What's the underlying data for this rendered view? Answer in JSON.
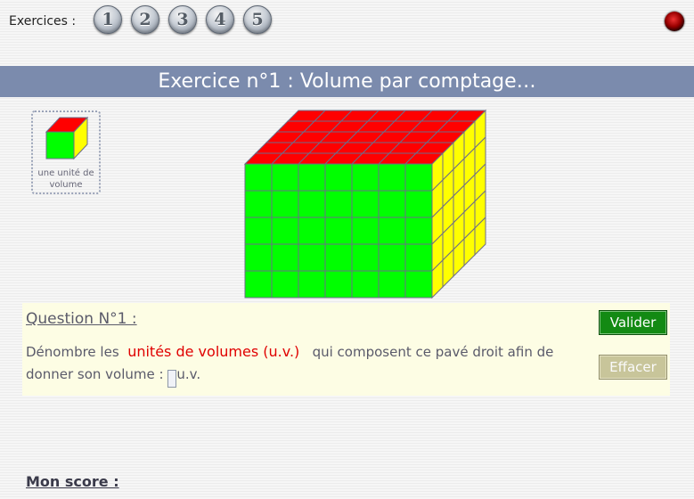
{
  "header": {
    "exercises_label": "Exercices :",
    "exercise_buttons": [
      "1",
      "2",
      "3",
      "4",
      "5"
    ]
  },
  "title": "Exercice n°1 : Volume par comptage…",
  "unit": {
    "label": "une unité de volume"
  },
  "figure": {
    "columns": 7,
    "rows": 5,
    "depth": 5,
    "front_color": "#00ff00",
    "top_color": "#ff0000",
    "side_color": "#ffff00"
  },
  "question": {
    "title": "Question N°1 :",
    "text_before": "Dénombre les",
    "highlight": "unités de volumes (u.v.)",
    "text_after": "qui composent ce pavé droit afin de donner son volume :",
    "unit_suffix": "u.v.",
    "answer_value": ""
  },
  "buttons": {
    "validate": "Valider",
    "clear": "Effacer"
  },
  "score": {
    "label": "Mon score :"
  },
  "colors": {
    "title_bar": "#7b8bad",
    "validate": "#138a13",
    "clear": "#c8c59a",
    "highlight": "#e00000"
  }
}
